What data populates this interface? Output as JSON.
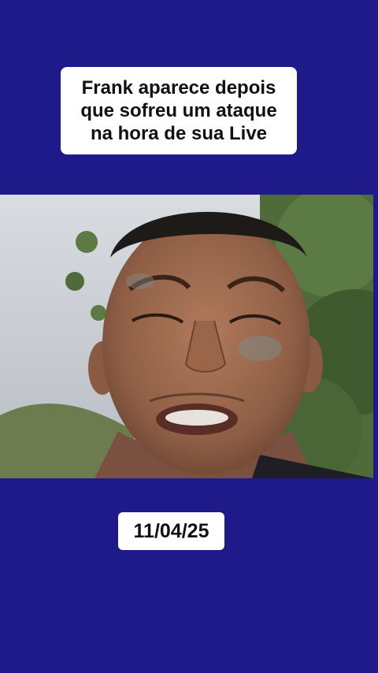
{
  "background_color": "#1f1a8a",
  "caption": {
    "lines": [
      "Frank aparece depois",
      "que sofreu um ataque",
      "na hora de sua Live"
    ]
  },
  "video": {
    "subject": "selfie video frame of a man outdoors with foliage and cloudy sky"
  },
  "date_badge": {
    "text": "11/04/25"
  }
}
